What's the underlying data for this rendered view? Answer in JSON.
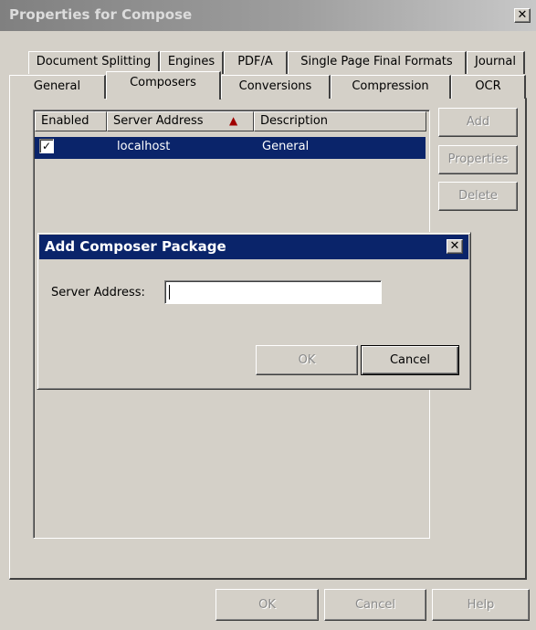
{
  "window": {
    "title": "Properties for Compose",
    "close_glyph": "✕"
  },
  "tabs": {
    "row_top": [
      "Document Splitting",
      "Engines",
      "PDF/A",
      "Single Page Final Formats",
      "Journal"
    ],
    "row_bottom": [
      "General",
      "Composers",
      "Conversions",
      "Compression",
      "OCR"
    ],
    "active": "Composers"
  },
  "listview": {
    "columns": [
      "Enabled",
      "Server Address",
      "Description"
    ],
    "sort_indicator": "▲",
    "rows": [
      {
        "enabled": true,
        "server_address": "localhost",
        "description": "General"
      }
    ],
    "check_glyph": "✓"
  },
  "side_buttons": {
    "add": "Add",
    "properties": "Properties",
    "delete": "Delete"
  },
  "dialog": {
    "title": "Add Composer Package",
    "close_glyph": "✕",
    "field_label": "Server Address:",
    "field_value": "",
    "ok": "OK",
    "cancel": "Cancel"
  },
  "footer": {
    "ok": "OK",
    "cancel": "Cancel",
    "help": "Help"
  },
  "colors": {
    "selection": "#0a246a",
    "sort_arrow": "#a00000",
    "face": "#d4d0c8"
  }
}
